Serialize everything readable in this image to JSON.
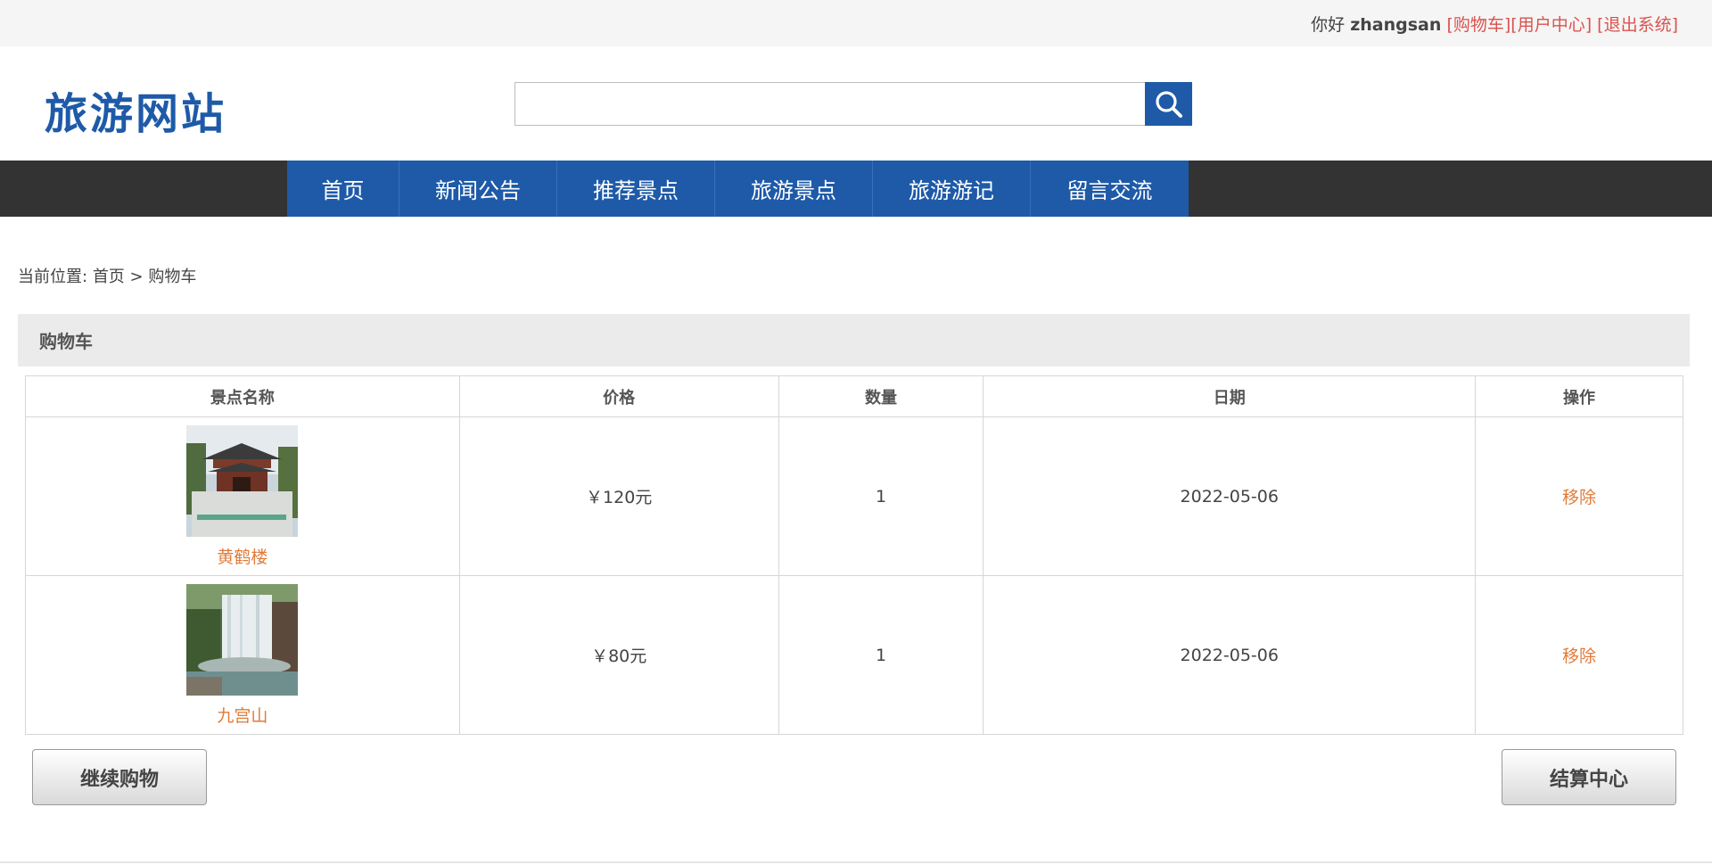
{
  "topbar": {
    "greeting": "你好",
    "username": "zhangsan",
    "cart_link": "[购物车]",
    "user_center_link": "[用户中心]",
    "logout_link": "[退出系统]"
  },
  "header": {
    "logo": "旅游网站",
    "search": {
      "placeholder": "",
      "value": ""
    }
  },
  "nav": {
    "items": [
      {
        "label": "首页"
      },
      {
        "label": "新闻公告"
      },
      {
        "label": "推荐景点"
      },
      {
        "label": "旅游景点"
      },
      {
        "label": "旅游游记"
      },
      {
        "label": "留言交流"
      }
    ]
  },
  "breadcrumb": {
    "prefix": "当前位置:",
    "home": "首页",
    "separator": ">",
    "current": "购物车"
  },
  "section": {
    "title": "购物车"
  },
  "table": {
    "headers": [
      "景点名称",
      "价格",
      "数量",
      "日期",
      "操作"
    ],
    "rows": [
      {
        "name": "黄鹤楼",
        "price": "￥120元",
        "qty": "1",
        "date": "2022-05-06",
        "action": "移除"
      },
      {
        "name": "九宫山",
        "price": "￥80元",
        "qty": "1",
        "date": "2022-05-06",
        "action": "移除"
      }
    ]
  },
  "buttons": {
    "continue": "继续购物",
    "checkout": "结算中心"
  },
  "colors": {
    "brand_blue": "#1e5aa8",
    "nav_dark": "#333333",
    "link_red": "#d9534f",
    "link_orange": "#e07b39"
  }
}
